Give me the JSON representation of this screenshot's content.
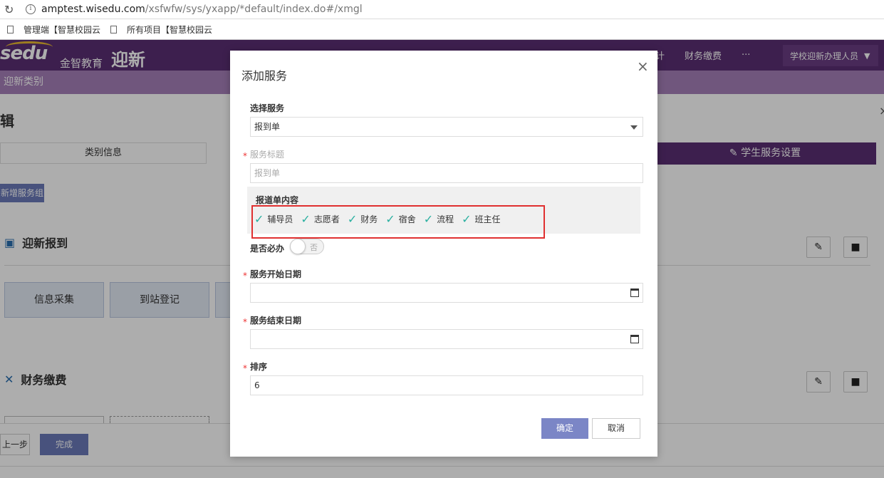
{
  "browser": {
    "url_host": "amptest.wisedu.com",
    "url_path": "/xsfwfw/sys/yxapp/*default/index.do#/xmgl",
    "bookmarks": [
      "管理端【智慧校园云",
      "所有项目【智慧校园云"
    ]
  },
  "app": {
    "logo_text": "sedu",
    "logo_cn": "金智教育",
    "app_title": "迎新",
    "nav_tail": [
      "计",
      "财务缴费",
      "···"
    ],
    "user_menu": "学校迎新办理人员",
    "subbar": "迎新类别",
    "page_title": "辑",
    "steps": {
      "step1": "类别信息",
      "step3": "学生服务设置"
    },
    "add_group": "新增服务组",
    "sections": [
      {
        "title": "迎新报到",
        "cards": [
          "信息采集",
          "到站登记"
        ]
      },
      {
        "title": "财务缴费"
      }
    ],
    "footer": {
      "prev": "上一步",
      "done": "完成"
    }
  },
  "modal": {
    "title": "添加服务",
    "close": "×",
    "select_service_label": "选择服务",
    "select_service_value": "报到单",
    "service_title_label": "服务标题",
    "service_title_placeholder": "报到单",
    "content_label": "报道单内容",
    "content_items": [
      "辅导员",
      "志愿者",
      "财务",
      "宿舍",
      "流程",
      "班主任"
    ],
    "required_label": "是否必办",
    "toggle_off": "否",
    "start_date_label": "服务开始日期",
    "end_date_label": "服务结束日期",
    "order_label": "排序",
    "order_value": "6",
    "ok": "确定",
    "cancel": "取消",
    "required_mark": "*"
  }
}
